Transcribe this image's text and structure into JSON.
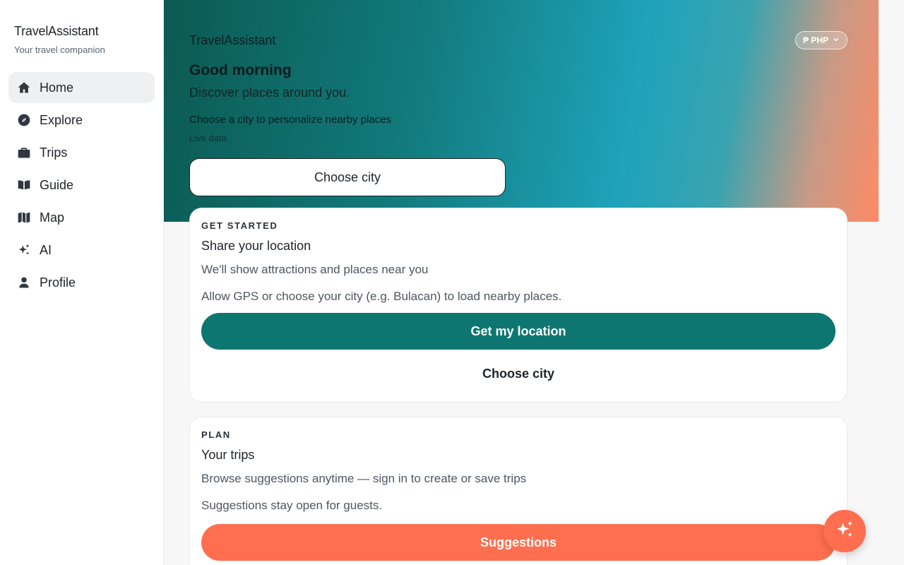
{
  "sidebar": {
    "brand_title": "TravelAssistant",
    "brand_subtitle": "Your travel companion",
    "items": [
      {
        "label": "Home",
        "icon": "home-icon",
        "active": true
      },
      {
        "label": "Explore",
        "icon": "compass-icon"
      },
      {
        "label": "Trips",
        "icon": "briefcase-icon"
      },
      {
        "label": "Guide",
        "icon": "book-icon"
      },
      {
        "label": "Map",
        "icon": "map-icon"
      },
      {
        "label": "AI",
        "icon": "sparkles-icon"
      },
      {
        "label": "Profile",
        "icon": "person-icon"
      }
    ]
  },
  "hero": {
    "app_name": "TravelAssistant",
    "currency": "₱ PHP",
    "greeting": "Good morning",
    "discover": "Discover places around you.",
    "choose_label": "Choose a city to personalize nearby places",
    "live_data": "Live data",
    "choose_city_button": "Choose city"
  },
  "get_started": {
    "eyebrow": "GET STARTED",
    "title": "Share your location",
    "subtitle": "We'll show attractions and places near you",
    "note": "Allow GPS or choose your city (e.g. Bulacan) to load nearby places.",
    "primary_button": "Get my location",
    "secondary_button": "Choose city"
  },
  "plan": {
    "eyebrow": "PLAN",
    "title": "Your trips",
    "subtitle": "Browse suggestions anytime — sign in to create or save trips",
    "note": "Suggestions stay open for guests.",
    "button": "Suggestions"
  },
  "colors": {
    "teal": "#0e7671",
    "coral": "#ff6e4e",
    "active_nav_bg": "#eef0f2"
  }
}
